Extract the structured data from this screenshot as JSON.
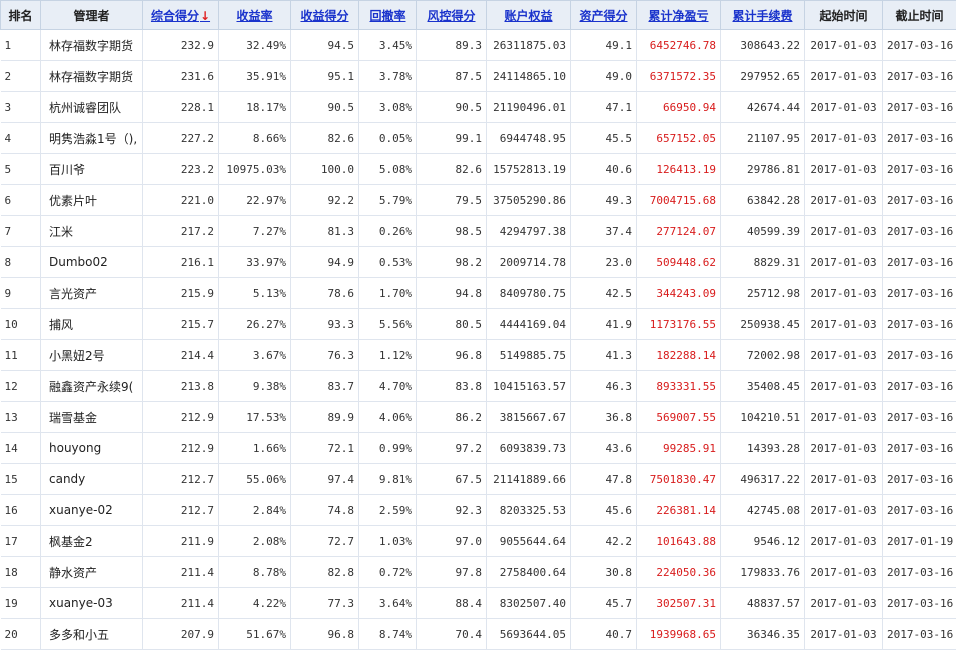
{
  "headers": {
    "rank": "排名",
    "manager": "管理者",
    "total_score": "综合得分",
    "sort_arrow": "↓",
    "return_rate": "收益率",
    "return_score": "收益得分",
    "drawdown": "回撤率",
    "risk_score": "风控得分",
    "equity": "账户权益",
    "asset_score": "资产得分",
    "net_pnl": "累计净盈亏",
    "fees": "累计手续费",
    "start": "起始时间",
    "end": "截止时间"
  },
  "rows": [
    {
      "rank": "1",
      "manager": "林存福数字期货",
      "total": "232.9",
      "ret": "32.49%",
      "retScore": "94.5",
      "dd": "3.45%",
      "risk": "89.3",
      "equity": "26311875.03",
      "asset": "49.1",
      "pnl": "6452746.78",
      "fees": "308643.22",
      "start": "2017-01-03",
      "end": "2017-03-16"
    },
    {
      "rank": "2",
      "manager": "林存福数字期货",
      "total": "231.6",
      "ret": "35.91%",
      "retScore": "95.1",
      "dd": "3.78%",
      "risk": "87.5",
      "equity": "24114865.10",
      "asset": "49.0",
      "pnl": "6371572.35",
      "fees": "297952.65",
      "start": "2017-01-03",
      "end": "2017-03-16"
    },
    {
      "rank": "3",
      "manager": "杭州诚睿团队",
      "total": "228.1",
      "ret": "18.17%",
      "retScore": "90.5",
      "dd": "3.08%",
      "risk": "90.5",
      "equity": "21190496.01",
      "asset": "47.1",
      "pnl": "66950.94",
      "fees": "42674.44",
      "start": "2017-01-03",
      "end": "2017-03-16"
    },
    {
      "rank": "4",
      "manager": "明隽浩淼1号（),",
      "total": "227.2",
      "ret": "8.66%",
      "retScore": "82.6",
      "dd": "0.05%",
      "risk": "99.1",
      "equity": "6944748.95",
      "asset": "45.5",
      "pnl": "657152.05",
      "fees": "21107.95",
      "start": "2017-01-03",
      "end": "2017-03-16"
    },
    {
      "rank": "5",
      "manager": "百川爷",
      "total": "223.2",
      "ret": "10975.03%",
      "retScore": "100.0",
      "dd": "5.08%",
      "risk": "82.6",
      "equity": "15752813.19",
      "asset": "40.6",
      "pnl": "126413.19",
      "fees": "29786.81",
      "start": "2017-01-03",
      "end": "2017-03-16"
    },
    {
      "rank": "6",
      "manager": "优素片叶",
      "total": "221.0",
      "ret": "22.97%",
      "retScore": "92.2",
      "dd": "5.79%",
      "risk": "79.5",
      "equity": "37505290.86",
      "asset": "49.3",
      "pnl": "7004715.68",
      "fees": "63842.28",
      "start": "2017-01-03",
      "end": "2017-03-16"
    },
    {
      "rank": "7",
      "manager": "江米",
      "total": "217.2",
      "ret": "7.27%",
      "retScore": "81.3",
      "dd": "0.26%",
      "risk": "98.5",
      "equity": "4294797.38",
      "asset": "37.4",
      "pnl": "277124.07",
      "fees": "40599.39",
      "start": "2017-01-03",
      "end": "2017-03-16"
    },
    {
      "rank": "8",
      "manager": "Dumbo02",
      "total": "216.1",
      "ret": "33.97%",
      "retScore": "94.9",
      "dd": "0.53%",
      "risk": "98.2",
      "equity": "2009714.78",
      "asset": "23.0",
      "pnl": "509448.62",
      "fees": "8829.31",
      "start": "2017-01-03",
      "end": "2017-03-16"
    },
    {
      "rank": "9",
      "manager": "言光资产",
      "total": "215.9",
      "ret": "5.13%",
      "retScore": "78.6",
      "dd": "1.70%",
      "risk": "94.8",
      "equity": "8409780.75",
      "asset": "42.5",
      "pnl": "344243.09",
      "fees": "25712.98",
      "start": "2017-01-03",
      "end": "2017-03-16"
    },
    {
      "rank": "10",
      "manager": "捕风",
      "total": "215.7",
      "ret": "26.27%",
      "retScore": "93.3",
      "dd": "5.56%",
      "risk": "80.5",
      "equity": "4444169.04",
      "asset": "41.9",
      "pnl": "1173176.55",
      "fees": "250938.45",
      "start": "2017-01-03",
      "end": "2017-03-16"
    },
    {
      "rank": "11",
      "manager": "小黑妞2号",
      "total": "214.4",
      "ret": "3.67%",
      "retScore": "76.3",
      "dd": "1.12%",
      "risk": "96.8",
      "equity": "5149885.75",
      "asset": "41.3",
      "pnl": "182288.14",
      "fees": "72002.98",
      "start": "2017-01-03",
      "end": "2017-03-16"
    },
    {
      "rank": "12",
      "manager": "融鑫资产永续9(",
      "total": "213.8",
      "ret": "9.38%",
      "retScore": "83.7",
      "dd": "4.70%",
      "risk": "83.8",
      "equity": "10415163.57",
      "asset": "46.3",
      "pnl": "893331.55",
      "fees": "35408.45",
      "start": "2017-01-03",
      "end": "2017-03-16"
    },
    {
      "rank": "13",
      "manager": "瑞雪基金",
      "total": "212.9",
      "ret": "17.53%",
      "retScore": "89.9",
      "dd": "4.06%",
      "risk": "86.2",
      "equity": "3815667.67",
      "asset": "36.8",
      "pnl": "569007.55",
      "fees": "104210.51",
      "start": "2017-01-03",
      "end": "2017-03-16"
    },
    {
      "rank": "14",
      "manager": "houyong",
      "total": "212.9",
      "ret": "1.66%",
      "retScore": "72.1",
      "dd": "0.99%",
      "risk": "97.2",
      "equity": "6093839.73",
      "asset": "43.6",
      "pnl": "99285.91",
      "fees": "14393.28",
      "start": "2017-01-03",
      "end": "2017-03-16"
    },
    {
      "rank": "15",
      "manager": "candy",
      "total": "212.7",
      "ret": "55.06%",
      "retScore": "97.4",
      "dd": "9.81%",
      "risk": "67.5",
      "equity": "21141889.66",
      "asset": "47.8",
      "pnl": "7501830.47",
      "fees": "496317.22",
      "start": "2017-01-03",
      "end": "2017-03-16"
    },
    {
      "rank": "16",
      "manager": "xuanye-02",
      "total": "212.7",
      "ret": "2.84%",
      "retScore": "74.8",
      "dd": "2.59%",
      "risk": "92.3",
      "equity": "8203325.53",
      "asset": "45.6",
      "pnl": "226381.14",
      "fees": "42745.08",
      "start": "2017-01-03",
      "end": "2017-03-16"
    },
    {
      "rank": "17",
      "manager": "枫基金2",
      "total": "211.9",
      "ret": "2.08%",
      "retScore": "72.7",
      "dd": "1.03%",
      "risk": "97.0",
      "equity": "9055644.64",
      "asset": "42.2",
      "pnl": "101643.88",
      "fees": "9546.12",
      "start": "2017-01-03",
      "end": "2017-01-19"
    },
    {
      "rank": "18",
      "manager": "静水资产",
      "total": "211.4",
      "ret": "8.78%",
      "retScore": "82.8",
      "dd": "0.72%",
      "risk": "97.8",
      "equity": "2758400.64",
      "asset": "30.8",
      "pnl": "224050.36",
      "fees": "179833.76",
      "start": "2017-01-03",
      "end": "2017-03-16"
    },
    {
      "rank": "19",
      "manager": "xuanye-03",
      "total": "211.4",
      "ret": "4.22%",
      "retScore": "77.3",
      "dd": "3.64%",
      "risk": "88.4",
      "equity": "8302507.40",
      "asset": "45.7",
      "pnl": "302507.31",
      "fees": "48837.57",
      "start": "2017-01-03",
      "end": "2017-03-16"
    },
    {
      "rank": "20",
      "manager": "多多和小五",
      "total": "207.9",
      "ret": "51.67%",
      "retScore": "96.8",
      "dd": "8.74%",
      "risk": "70.4",
      "equity": "5693644.05",
      "asset": "40.7",
      "pnl": "1939968.65",
      "fees": "36346.35",
      "start": "2017-01-03",
      "end": "2017-03-16"
    }
  ],
  "colors": {
    "link": "#1a33cc",
    "pnl_red": "#d81b1b",
    "header_bg": "#e8eef6"
  }
}
